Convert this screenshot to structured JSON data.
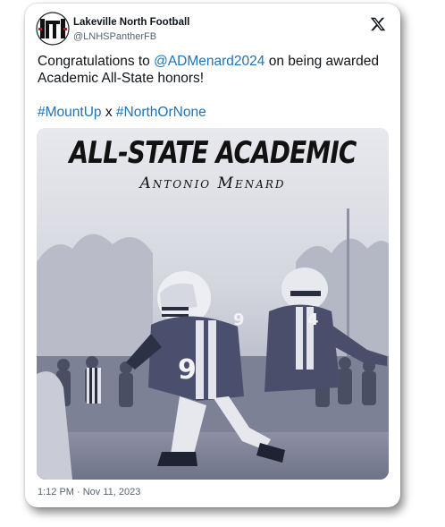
{
  "account": {
    "name": "Lakeville North Football",
    "handle": "@LNHSPantherFB"
  },
  "tweet": {
    "text_before": "Congratulations to ",
    "mention": "@ADMenard2024",
    "text_after": " on being awarded Academic All-State honors!",
    "hashtag_1": "#MountUp",
    "separator": " x ",
    "hashtag_2": "#NorthOrNone",
    "timestamp": "1:12 PM · Nov 11, 2023"
  },
  "media": {
    "title": "ALL-STATE ACADEMIC",
    "player_name": "Antonio Menard",
    "jersey_front": "9",
    "jersey_back": "4"
  },
  "colors": {
    "link": "#1d73b8",
    "text": "#0f1419",
    "secondary": "#536471",
    "photo_tint": "#9ea3b8"
  },
  "icons": {
    "brand": "x-logo-icon",
    "avatar": "team-logo-icon"
  }
}
